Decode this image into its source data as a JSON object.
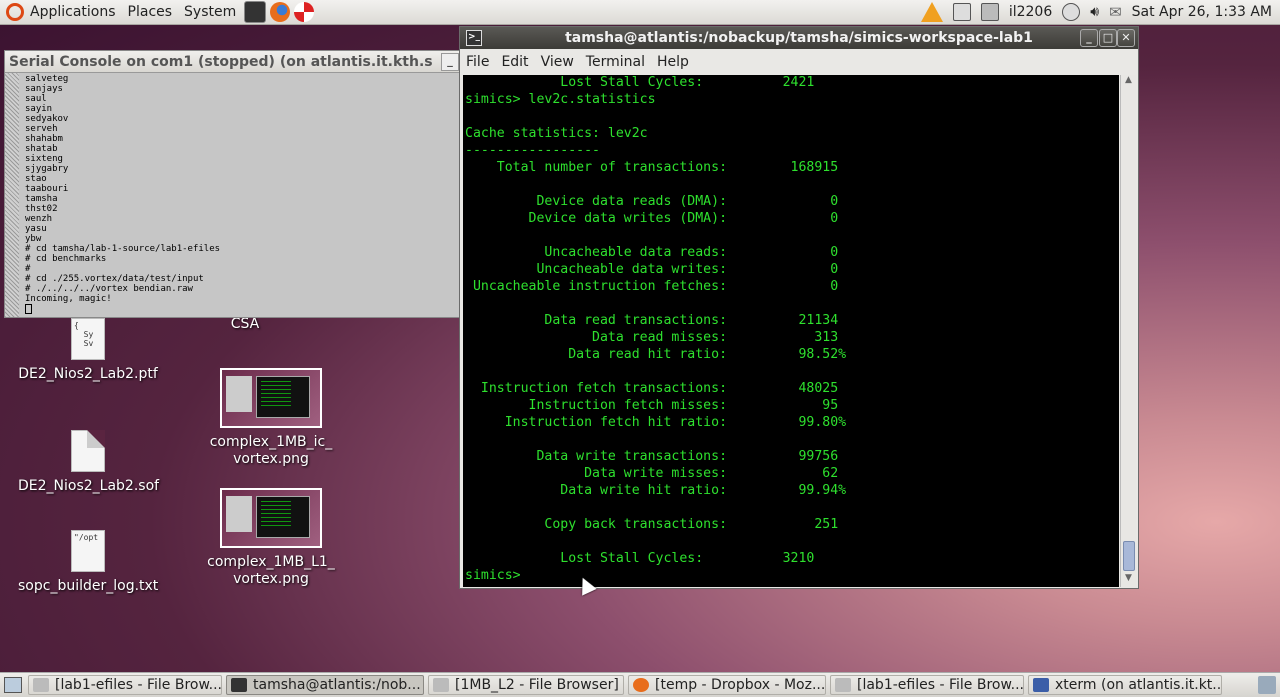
{
  "top_panel": {
    "menus": [
      "Applications",
      "Places",
      "System"
    ],
    "user": "il2206",
    "clock": "Sat Apr 26,  1:33 AM",
    "icons": [
      "ubuntu-logo-icon",
      "terminal-launcher-icon",
      "firefox-icon",
      "help-icon",
      "warning-icon",
      "network-icon",
      "keyboard-icon",
      "power-icon",
      "volume-icon",
      "mail-icon"
    ]
  },
  "desktop": {
    "icons": [
      {
        "label": "CSA",
        "kind": "folder"
      },
      {
        "label": "DE2_Nios2_Lab2.ptf",
        "kind": "text",
        "preview": "{\n  Sy\n  Sv"
      },
      {
        "label": "complex_1MB_ic_\nvortex.png",
        "kind": "image"
      },
      {
        "label": "DE2_Nios2_Lab2.sof",
        "kind": "doc"
      },
      {
        "label": "complex_1MB_L1_\nvortex.png",
        "kind": "image"
      },
      {
        "label": "sopc_builder_log.txt",
        "kind": "text",
        "preview": "\"/opt"
      }
    ]
  },
  "serial_console": {
    "title": "Serial Console on com1 (stopped) (on atlantis.it.kth.s",
    "lines": [
      "salveteg",
      "sanjays",
      "saul",
      "sayin",
      "sedyakov",
      "serveh",
      "shahabm",
      "shatab",
      "sixteng",
      "sjygabry",
      "stao",
      "taabouri",
      "tamsha",
      "thst02",
      "wenzh",
      "yasu",
      "ybw",
      "# cd tamsha/lab-1-source/lab1-efiles",
      "# cd benchmarks",
      "#",
      "# cd ./255.vortex/data/test/input",
      "# ./../../../vortex bendian.raw",
      "Incoming, magic!"
    ]
  },
  "terminal": {
    "title": "tamsha@atlantis:/nobackup/tamsha/simics-workspace-lab1",
    "menu": [
      "File",
      "Edit",
      "View",
      "Terminal",
      "Help"
    ],
    "lines": [
      "            Lost Stall Cycles:          2421",
      "simics> lev2c.statistics",
      "",
      "Cache statistics: lev2c",
      "-----------------",
      "    Total number of transactions:        168915",
      "",
      "         Device data reads (DMA):             0",
      "        Device data writes (DMA):             0",
      "",
      "          Uncacheable data reads:             0",
      "         Uncacheable data writes:             0",
      " Uncacheable instruction fetches:             0",
      "",
      "          Data read transactions:         21134",
      "                Data read misses:           313",
      "             Data read hit ratio:         98.52%",
      "",
      "  Instruction fetch transactions:         48025",
      "        Instruction fetch misses:            95",
      "     Instruction fetch hit ratio:         99.80%",
      "",
      "         Data write transactions:         99756",
      "               Data write misses:            62",
      "            Data write hit ratio:         99.94%",
      "",
      "          Copy back transactions:           251",
      "",
      "            Lost Stall Cycles:          3210",
      "simics> "
    ]
  },
  "taskbar": {
    "items": [
      {
        "label": "[lab1-efiles - File Brow...",
        "icon": "file-browser-icon",
        "active": false
      },
      {
        "label": "tamsha@atlantis:/nob...",
        "icon": "terminal-icon",
        "active": true
      },
      {
        "label": "[1MB_L2 - File Browser]",
        "icon": "file-browser-icon",
        "active": false
      },
      {
        "label": "[temp - Dropbox - Moz...",
        "icon": "firefox-icon",
        "active": false
      },
      {
        "label": "[lab1-efiles - File Brow...",
        "icon": "file-browser-icon",
        "active": false
      },
      {
        "label": "xterm (on atlantis.it.kt...",
        "icon": "xterm-icon",
        "active": false
      }
    ]
  }
}
